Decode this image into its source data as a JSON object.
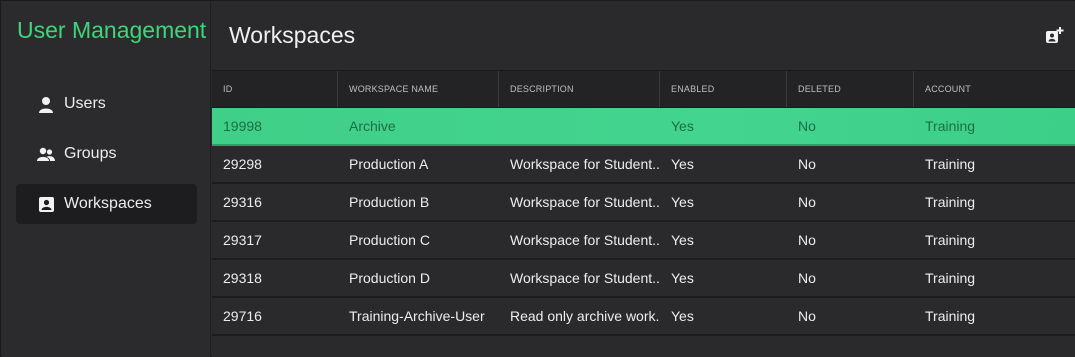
{
  "sidebar": {
    "title": "User Management",
    "items": [
      {
        "label": "Users",
        "icon": "user-icon"
      },
      {
        "label": "Groups",
        "icon": "group-icon"
      },
      {
        "label": "Workspaces",
        "icon": "workspace-icon",
        "active": true
      }
    ]
  },
  "header": {
    "title": "Workspaces",
    "add_icon": "add-workspace-icon"
  },
  "table": {
    "columns": [
      "ID",
      "WORKSPACE NAME",
      "DESCRIPTION",
      "ENABLED",
      "DELETED",
      "ACCOUNT"
    ],
    "rows": [
      {
        "id": "19998",
        "name": "Archive",
        "description": "",
        "enabled": "Yes",
        "deleted": "No",
        "account": "Training",
        "selected": true
      },
      {
        "id": "29298",
        "name": "Production A",
        "description": "Workspace for Student...",
        "enabled": "Yes",
        "deleted": "No",
        "account": "Training"
      },
      {
        "id": "29316",
        "name": "Production B",
        "description": "Workspace for Student...",
        "enabled": "Yes",
        "deleted": "No",
        "account": "Training"
      },
      {
        "id": "29317",
        "name": "Production C",
        "description": "Workspace for Student...",
        "enabled": "Yes",
        "deleted": "No",
        "account": "Training"
      },
      {
        "id": "29318",
        "name": "Production D",
        "description": "Workspace for Student...",
        "enabled": "Yes",
        "deleted": "No",
        "account": "Training"
      },
      {
        "id": "29716",
        "name": "Training-Archive-User",
        "description": "Read only archive work...",
        "enabled": "Yes",
        "deleted": "No",
        "account": "Training"
      }
    ]
  },
  "colors": {
    "accent": "#3dd67b",
    "selected_row": "#42d38d",
    "selected_text": "#1c6d46",
    "background": "#2a2a2c"
  }
}
